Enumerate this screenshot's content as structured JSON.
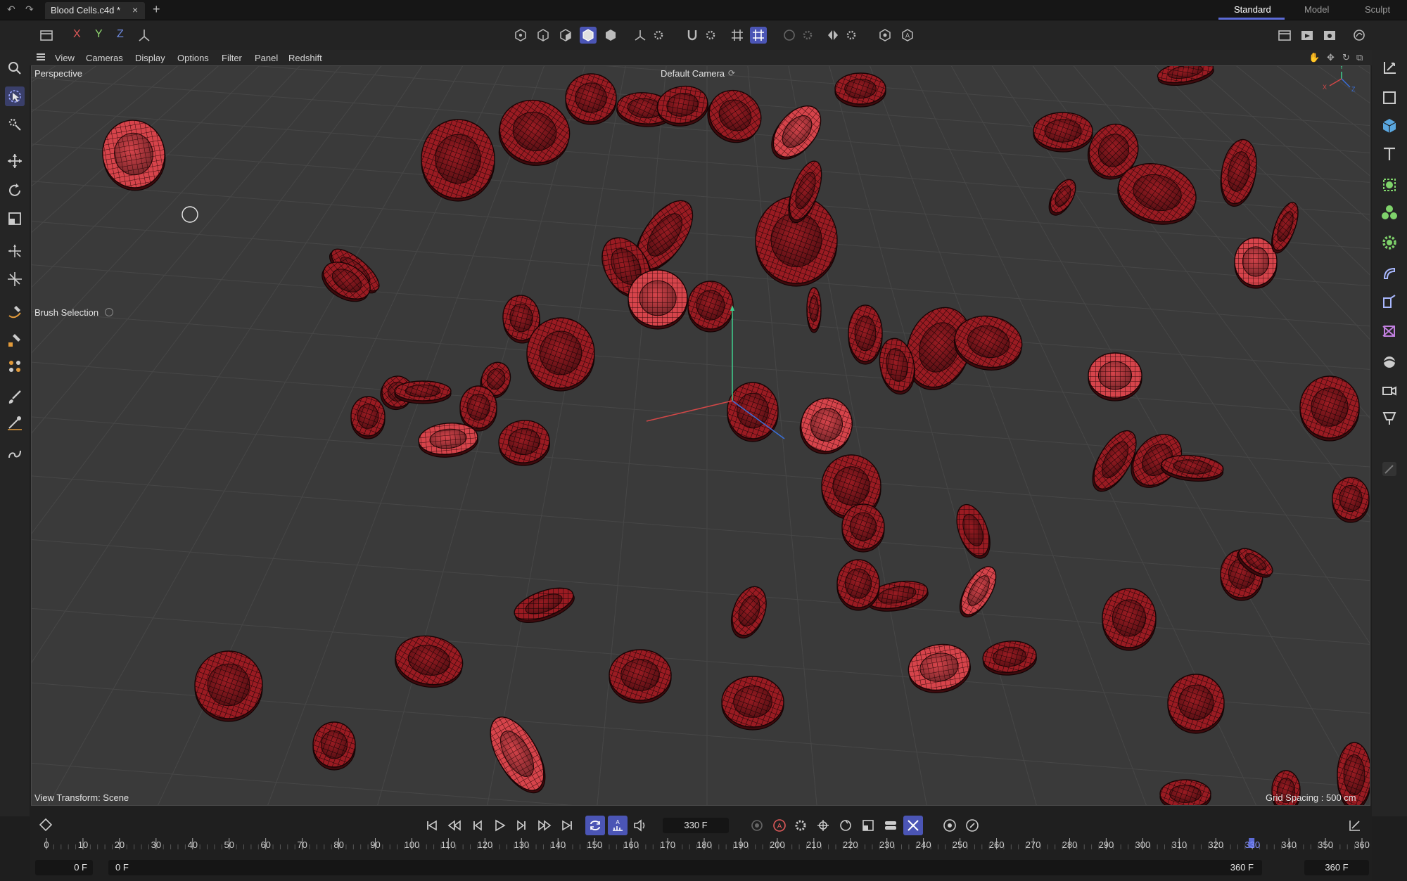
{
  "window": {
    "document_tab": "Blood Cells.c4d *",
    "layouts": [
      "Standard",
      "Model",
      "Sculpt"
    ],
    "active_layout": "Standard"
  },
  "toolbar": {
    "axis_x": "X",
    "axis_y": "Y",
    "axis_z": "Z"
  },
  "viewport_menu": [
    "View",
    "Cameras",
    "Display",
    "Options",
    "Filter",
    "Panel",
    "Redshift"
  ],
  "viewport": {
    "projection": "Perspective",
    "camera": "Default Camera",
    "active_tool": "Brush Selection",
    "view_transform": "View Transform: Scene",
    "grid_spacing": "Grid Spacing : 500 cm",
    "gizmo_axes": [
      "X",
      "Y",
      "Z"
    ],
    "colors": {
      "cell": "#8a1419",
      "cell_light": "#c8323a",
      "background": "#3a3a3a",
      "grid": "#4a4a4a"
    }
  },
  "timeline": {
    "current_frame": "330 F",
    "ticks": [
      "0",
      "10",
      "20",
      "30",
      "40",
      "50",
      "60",
      "70",
      "80",
      "90",
      "100",
      "110",
      "120",
      "130",
      "140",
      "150",
      "160",
      "170",
      "180",
      "190",
      "200",
      "210",
      "220",
      "230",
      "240",
      "250",
      "260",
      "270",
      "280",
      "290",
      "300",
      "310",
      "320",
      "330",
      "340",
      "350",
      "360"
    ],
    "playhead_value": 330,
    "range_start": "0 F",
    "range_preview_start": "0 F",
    "range_preview_end": "360 F",
    "range_end": "360 F",
    "accent": "#5c6bd6"
  }
}
